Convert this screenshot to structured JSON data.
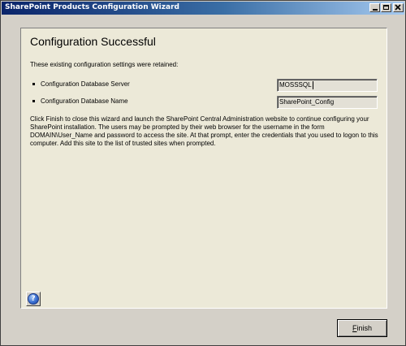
{
  "window": {
    "title": "SharePoint Products Configuration Wizard",
    "controls": [
      "minimize-icon",
      "maximize-icon",
      "close-icon"
    ]
  },
  "main": {
    "heading": "Configuration Successful",
    "retained_text": "These existing configuration settings were retained:",
    "settings": [
      {
        "label": "Configuration Database Server",
        "value": "MOSSSQL"
      },
      {
        "label": "Configuration Database Name",
        "value": "SharePoint_Config"
      }
    ],
    "info_text": "Click Finish to close this wizard and launch the SharePoint Central Administration website to continue configuring your SharePoint installation. The users may be prompted by their web browser for the username in the form DOMAIN\\User_Name and password to access the site. At that prompt, enter the credentials that you used to logon to this computer. Add this site to the list of trusted sites when prompted."
  },
  "footer": {
    "help_icon": "help-icon",
    "help_glyph": "?",
    "finish_accel": "F",
    "finish_rest": "inish"
  },
  "colors": {
    "titlebar_start": "#0a246a",
    "titlebar_end": "#a6caf0",
    "window_bg": "#d4d0c8",
    "panel_bg": "#ece9d8"
  }
}
